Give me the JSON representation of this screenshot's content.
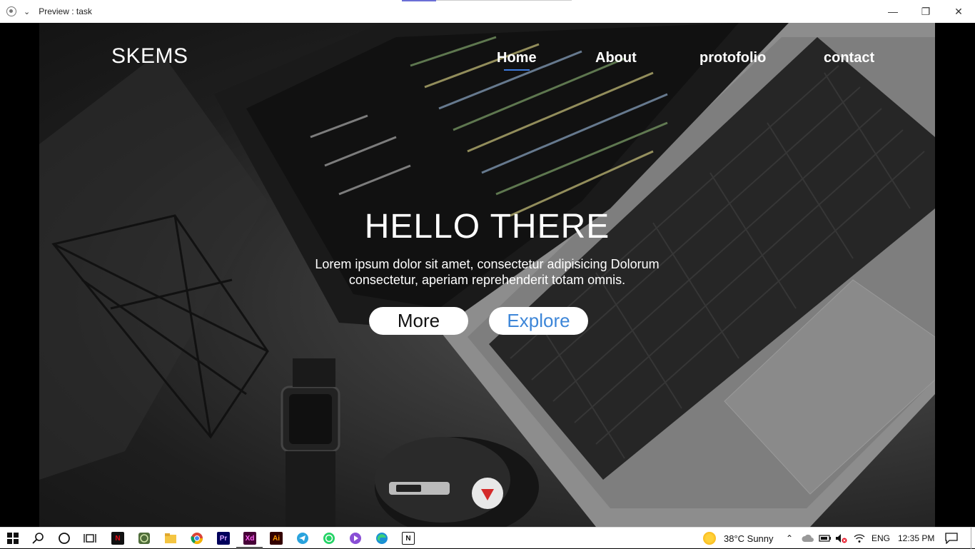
{
  "window": {
    "title": "Preview : task"
  },
  "site": {
    "logo": "SKEMS",
    "nav": {
      "home": "Home",
      "about": "About",
      "portfolio": "protofolio",
      "contact": "contact"
    },
    "headline": "HELLO THERE",
    "subtext_line1": "Lorem ipsum dolor sit amet, consectetur adipisicing Dolorum",
    "subtext_line2": "consectetur, aperiam reprehenderit totam omnis.",
    "buttons": {
      "more": "More",
      "explore": "Explore"
    },
    "colors": {
      "accent": "#3d7be0",
      "explore_text": "#3d86d8",
      "scroll_arrow": "#d42a2a"
    }
  },
  "taskbar": {
    "apps": [
      "windows-start-icon",
      "search-icon",
      "cortana-icon",
      "task-view-icon",
      "netflix-icon",
      "camtasia-icon",
      "file-explorer-icon",
      "chrome-icon",
      "premiere-pro-icon",
      "adobe-xd-icon",
      "illustrator-icon",
      "telegram-icon",
      "whatsapp-icon",
      "media-player-icon",
      "edge-icon",
      "notion-icon"
    ],
    "labels": {
      "netflix": "N",
      "premiere": "Pr",
      "xd": "Xd",
      "illustrator": "Ai",
      "notion": "N"
    },
    "weather": "38°C  Sunny",
    "language": "ENG",
    "time": "12:35 PM"
  }
}
